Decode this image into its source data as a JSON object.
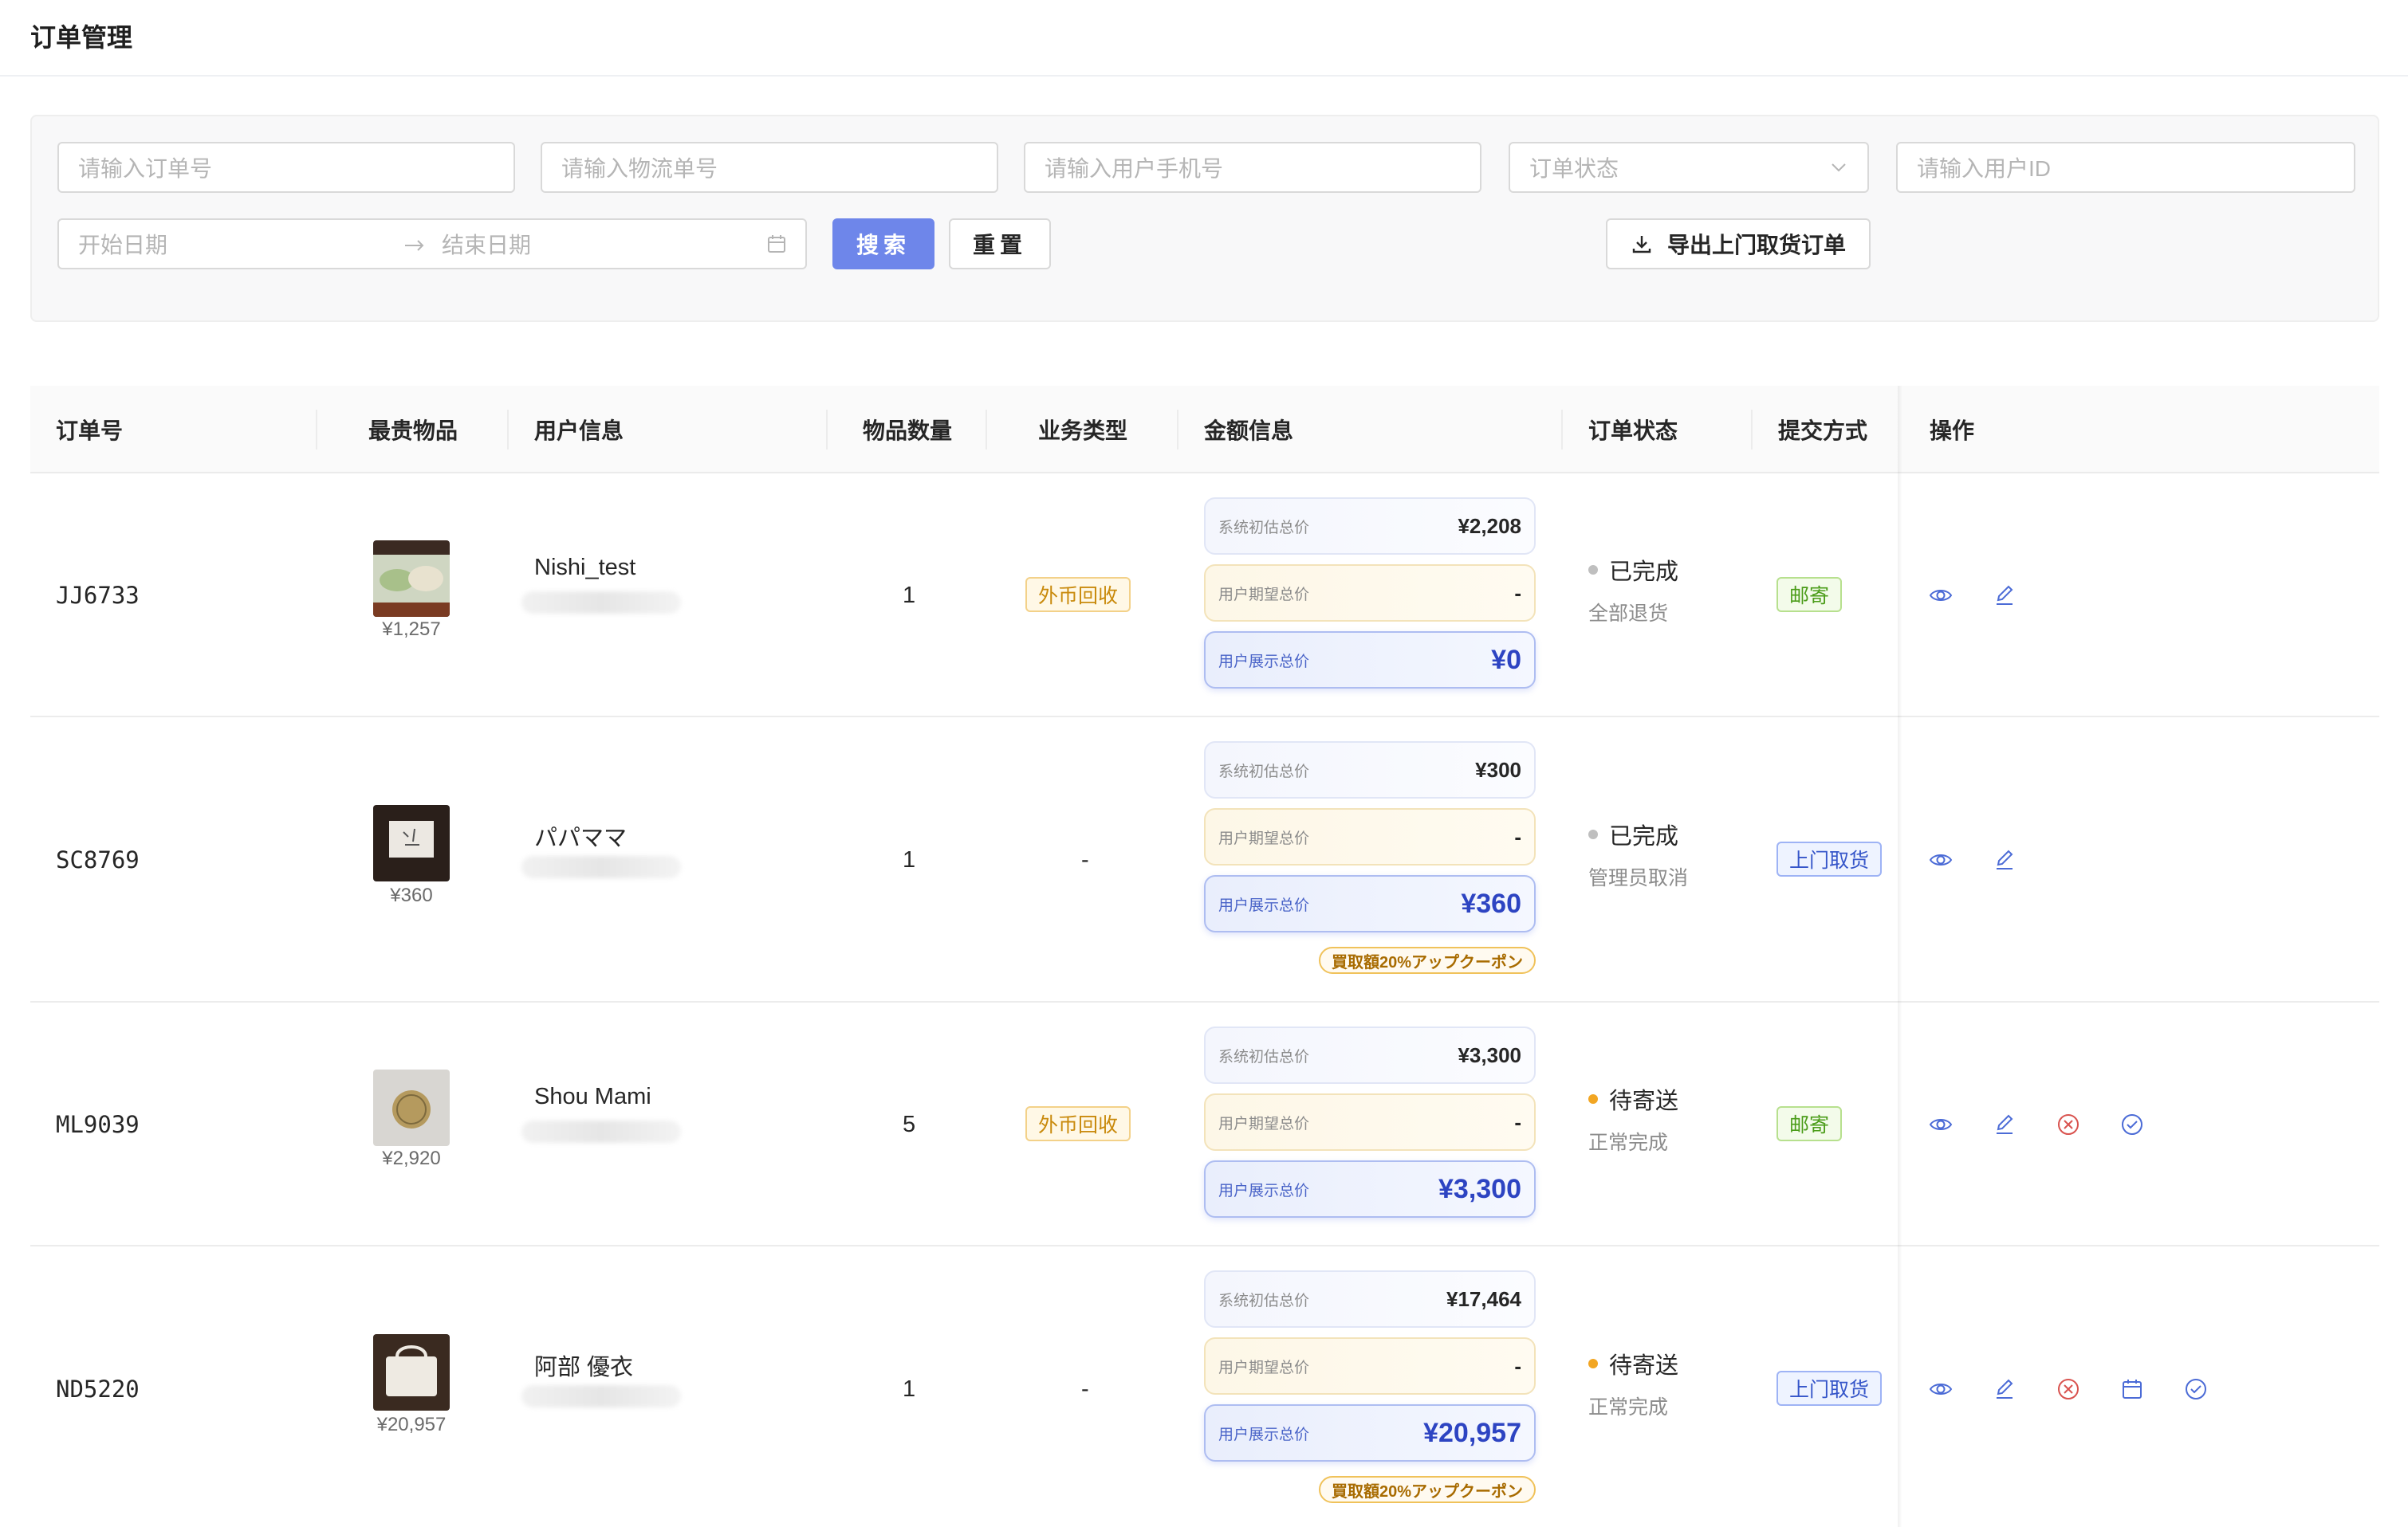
{
  "header": {
    "title": "订单管理"
  },
  "filters": {
    "order_no_placeholder": "请输入订单号",
    "logistics_no_placeholder": "请输入物流单号",
    "phone_placeholder": "请输入用户手机号",
    "status_placeholder": "订单状态",
    "user_id_placeholder": "请输入用户ID",
    "start_date_placeholder": "开始日期",
    "end_date_placeholder": "结束日期",
    "search_label": "搜索",
    "reset_label": "重置",
    "export_label": "导出上门取货订单"
  },
  "table": {
    "columns": [
      "订单号",
      "最贵物品",
      "用户信息",
      "物品数量",
      "业务类型",
      "金额信息",
      "订单状态",
      "提交方式",
      "操作"
    ],
    "price_labels": {
      "system": "系统初估总价",
      "expected": "用户期望总价",
      "display": "用户展示总价"
    },
    "rows": [
      {
        "order_no": "JJ6733",
        "item_price": "¥1,257",
        "user_name": "Nishi_test",
        "quantity": "1",
        "business_type": "外币回收",
        "system_total": "¥2,208",
        "expected_total": "-",
        "display_total": "¥0",
        "coupon": "",
        "status": "已完成",
        "status_color": "#bfbfbf",
        "sub_status": "全部退货",
        "submit_method": "邮寄",
        "actions": [
          "eye-icon",
          "edit-icon"
        ]
      },
      {
        "order_no": "SC8769",
        "item_price": "¥360",
        "user_name": "パパママ",
        "quantity": "1",
        "business_type": "-",
        "system_total": "¥300",
        "expected_total": "-",
        "display_total": "¥360",
        "coupon": "買取額20%アップクーポン",
        "status": "已完成",
        "status_color": "#bfbfbf",
        "sub_status": "管理员取消",
        "submit_method": "上门取货",
        "actions": [
          "eye-icon",
          "edit-icon"
        ]
      },
      {
        "order_no": "ML9039",
        "item_price": "¥2,920",
        "user_name": "Shou Mami",
        "quantity": "5",
        "business_type": "外币回收",
        "system_total": "¥3,300",
        "expected_total": "-",
        "display_total": "¥3,300",
        "coupon": "",
        "status": "待寄送",
        "status_color": "#f2a623",
        "sub_status": "正常完成",
        "submit_method": "邮寄",
        "actions": [
          "eye-icon",
          "edit-icon",
          "cancel-icon",
          "check-circle-icon"
        ]
      },
      {
        "order_no": "ND5220",
        "item_price": "¥20,957",
        "user_name": "阿部 優衣",
        "quantity": "1",
        "business_type": "-",
        "system_total": "¥17,464",
        "expected_total": "-",
        "display_total": "¥20,957",
        "coupon": "買取額20%アップクーポン",
        "status": "待寄送",
        "status_color": "#f2a623",
        "sub_status": "正常完成",
        "submit_method": "上门取货",
        "actions": [
          "eye-icon",
          "edit-icon",
          "cancel-icon",
          "calendar-icon",
          "check-circle-icon"
        ]
      }
    ]
  },
  "colors": {
    "primary": "#6e86ea",
    "action_blue": "#4b6bd6",
    "action_red": "#d9534f"
  }
}
